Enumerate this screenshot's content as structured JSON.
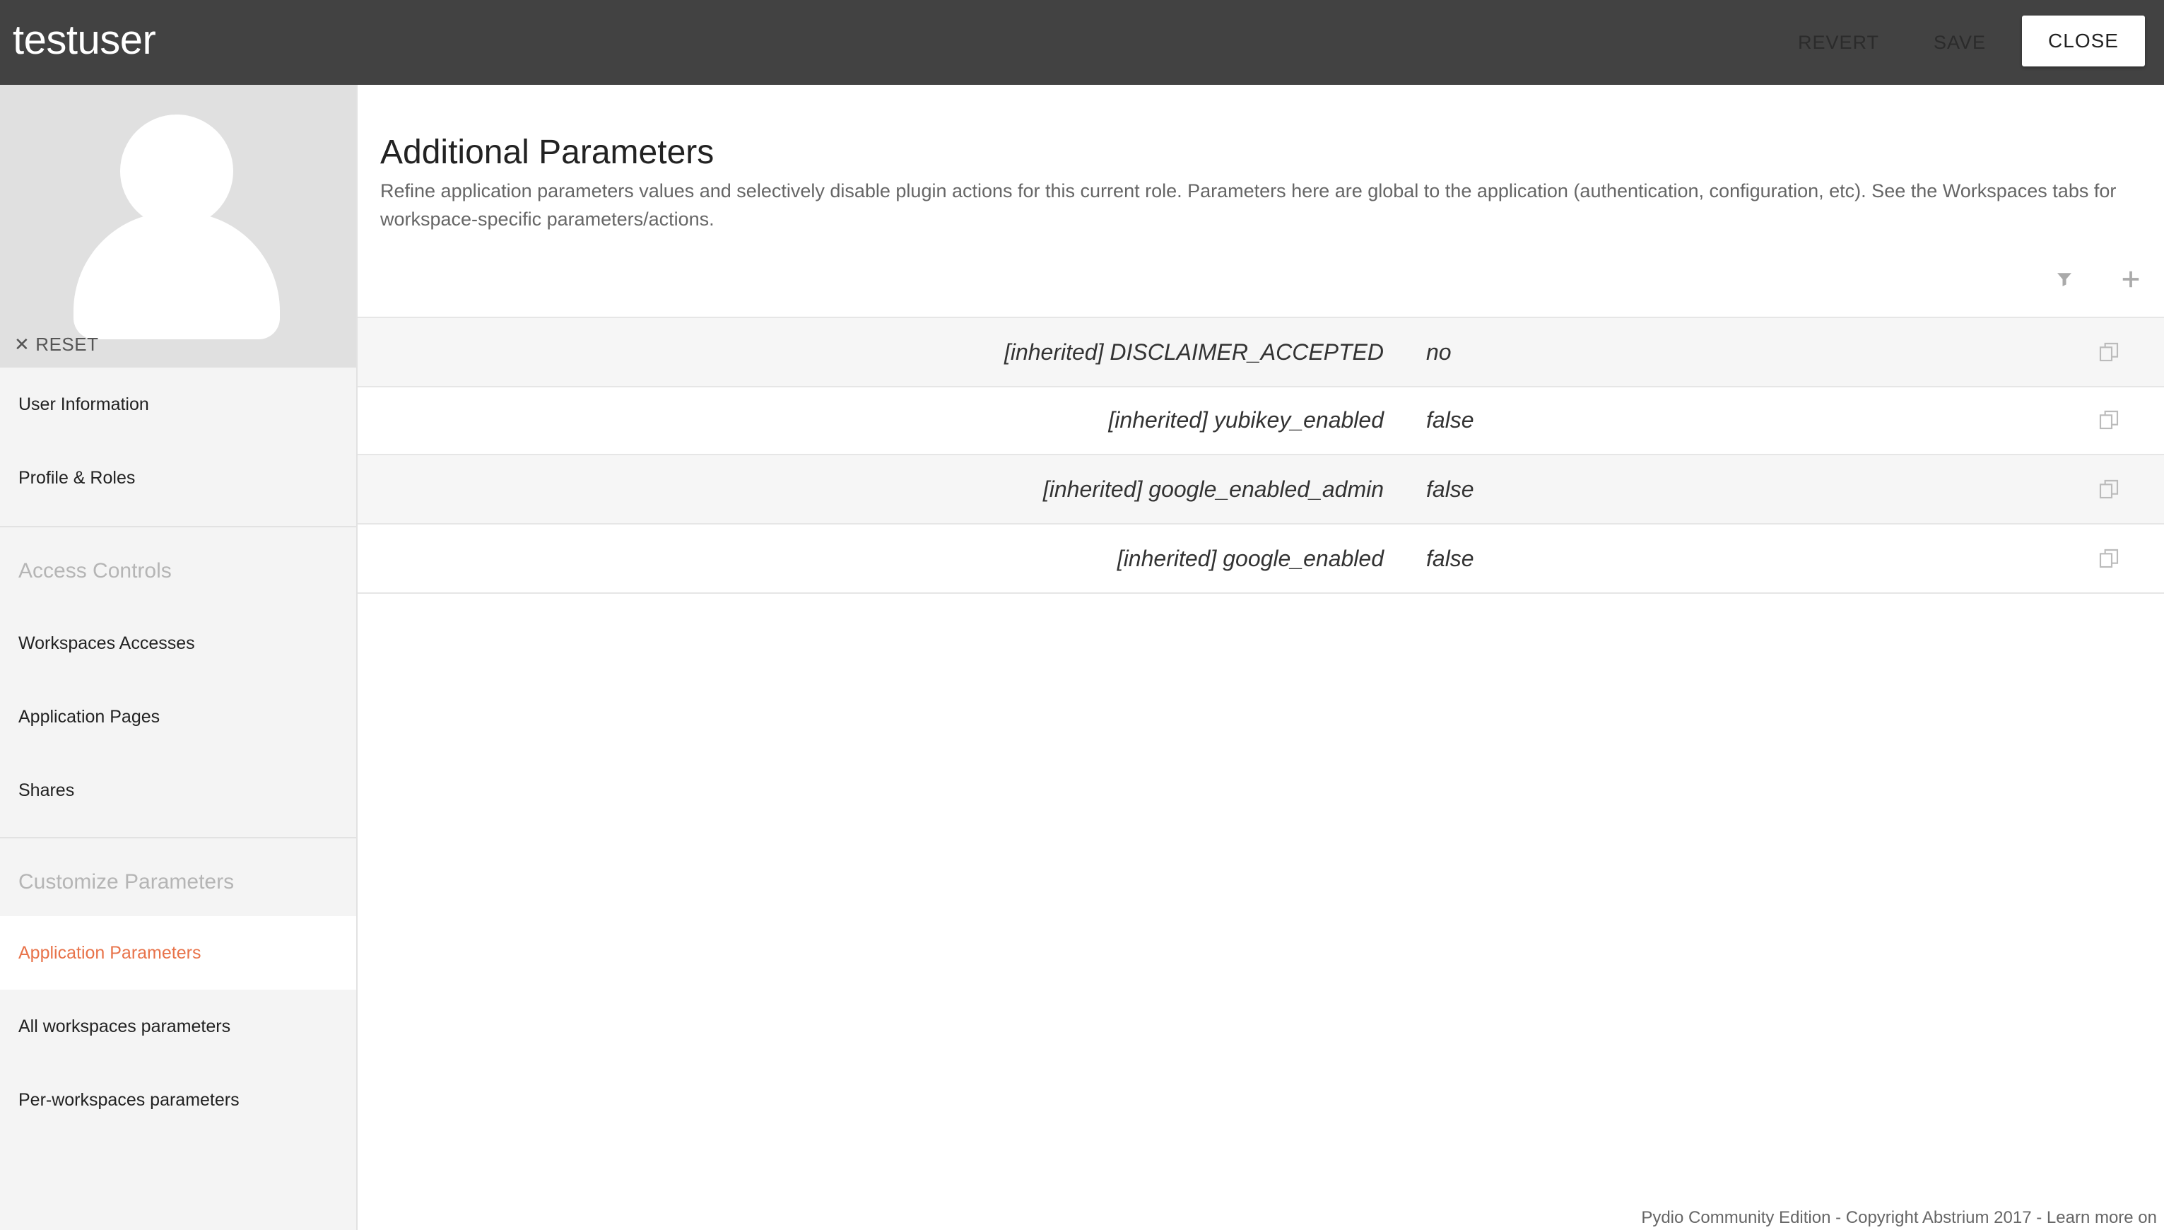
{
  "header": {
    "title": "testuser",
    "revert_label": "REVERT",
    "save_label": "SAVE",
    "close_label": "CLOSE"
  },
  "sidebar": {
    "reset_label": "RESET",
    "items": [
      {
        "label": "User Information"
      },
      {
        "label": "Profile & Roles"
      }
    ],
    "section_access": "Access Controls",
    "access_items": [
      {
        "label": "Workspaces Accesses"
      },
      {
        "label": "Application Pages"
      },
      {
        "label": "Shares"
      }
    ],
    "section_custom": "Customize Parameters",
    "custom_items": [
      {
        "label": "Application Parameters",
        "active": true
      },
      {
        "label": "All workspaces parameters"
      },
      {
        "label": "Per-workspaces parameters"
      }
    ]
  },
  "main": {
    "title": "Additional Parameters",
    "description": "Refine application parameters values and selectively disable plugin actions for this current role. Parameters here are global to the application (authentication, configuration, etc). See the Workspaces tabs for workspace-specific parameters/actions.",
    "rows": [
      {
        "key": "[inherited] DISCLAIMER_ACCEPTED",
        "value": "no"
      },
      {
        "key": "[inherited] yubikey_enabled",
        "value": "false"
      },
      {
        "key": "[inherited] google_enabled_admin",
        "value": "false"
      },
      {
        "key": "[inherited] google_enabled",
        "value": "false"
      }
    ]
  },
  "footer": {
    "text": "Pydio Community Edition - Copyright Abstrium 2017 - Learn more on"
  },
  "colors": {
    "topbar": "#424242",
    "accent": "#e8734a",
    "sidebar_bg": "#f4f4f4"
  }
}
